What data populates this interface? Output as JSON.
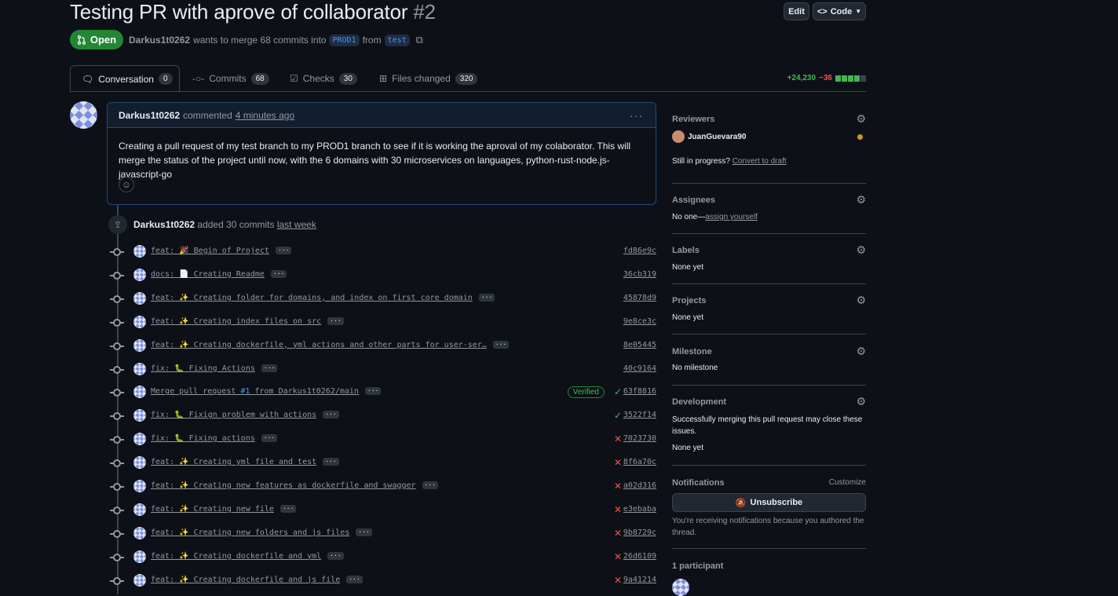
{
  "pr": {
    "title": "Testing PR with aprove of collaborator",
    "number": "#2",
    "state": "Open",
    "author": "Darkus1t0262",
    "merge_text": "wants to merge 68 commits into",
    "base_branch": "PROD1",
    "from_text": "from",
    "head_branch": "test"
  },
  "header_buttons": {
    "edit": "Edit",
    "code": "Code"
  },
  "tabs": [
    {
      "label": "Conversation",
      "count": "0"
    },
    {
      "label": "Commits",
      "count": "68"
    },
    {
      "label": "Checks",
      "count": "30"
    },
    {
      "label": "Files changed",
      "count": "320"
    }
  ],
  "diffstat": {
    "additions": "+24,230",
    "deletions": "−36"
  },
  "comment": {
    "author": "Darkus1t0262",
    "action": "commented",
    "time": "4 minutes ago",
    "body": "Creating a pull request of my test branch to my PROD1 branch to see if it is working the aproval of my colaborator. This will merge the status of the project until now, with the 6 domains with 30 microservices on languages, python-rust-node.js-javascript-go"
  },
  "push_event": {
    "author": "Darkus1t0262",
    "action": "added 30 commits",
    "time": "last week"
  },
  "commits": [
    {
      "message": "feat: 🎉 Begin of Project",
      "sha": "fd86e9c",
      "status": ""
    },
    {
      "message": "docs: 📄 Creating Readme",
      "sha": "36cb319",
      "status": ""
    },
    {
      "message": "feat: ✨ Creating folder for domains, and index on first core domain",
      "sha": "45878d9",
      "status": ""
    },
    {
      "message": "feat: ✨ Creating index files on src",
      "sha": "9e8ce3c",
      "status": ""
    },
    {
      "message": "feat: ✨ Creating dockerfile, yml actions and other parts for user-ser…",
      "sha": "8e05445",
      "status": ""
    },
    {
      "message": "fix: 🐛 Fixing Actions",
      "sha": "40c9164",
      "status": ""
    },
    {
      "message": "Merge pull request",
      "pr_ref": "#1",
      "message_suffix": "from Darkus1t0262/main",
      "sha": "63f8816",
      "status": "ok",
      "badge": "Verified"
    },
    {
      "message": "fix: 🐛 Fixign problem with actions",
      "sha": "3522f14",
      "status": "ok"
    },
    {
      "message": "fix: 🐛 Fixing actions",
      "sha": "7023730",
      "status": "fail"
    },
    {
      "message": "feat: ✨ Creating yml file and test",
      "sha": "8f6a70c",
      "status": "fail"
    },
    {
      "message": "feat: ✨ Creating new features as dockerfile and swagger",
      "sha": "a02d316",
      "status": "fail"
    },
    {
      "message": "feat: ✨ Creating new file",
      "sha": "e3ebaba",
      "status": "fail"
    },
    {
      "message": "feat: ✨ Creating new folders and js files",
      "sha": "9b8729c",
      "status": "fail"
    },
    {
      "message": "feat: ✨ Creating dockerfile and yml",
      "sha": "26d6109",
      "status": "fail"
    },
    {
      "message": "feat: ✨ Creating dockerfile and js file",
      "sha": "9a41214",
      "status": "fail"
    }
  ],
  "sidebar": {
    "reviewers": {
      "title": "Reviewers",
      "name": "JuanGuevara90",
      "progress": "Still in progress?",
      "convert": "Convert to draft"
    },
    "assignees": {
      "title": "Assignees",
      "value": "No one—",
      "link": "assign yourself"
    },
    "labels": {
      "title": "Labels",
      "value": "None yet"
    },
    "projects": {
      "title": "Projects",
      "value": "None yet"
    },
    "milestone": {
      "title": "Milestone",
      "value": "No milestone"
    },
    "development": {
      "title": "Development",
      "desc": "Successfully merging this pull request may close these issues.",
      "value": "None yet"
    },
    "notifications": {
      "title": "Notifications",
      "customize": "Customize",
      "button": "Unsubscribe",
      "desc": "You're receiving notifications because you authored the thread."
    },
    "participants": {
      "title": "1 participant"
    }
  },
  "colors": {
    "open": "#238636",
    "link": "#4493f8",
    "fail": "#f85149",
    "ok": "#3fb950"
  }
}
